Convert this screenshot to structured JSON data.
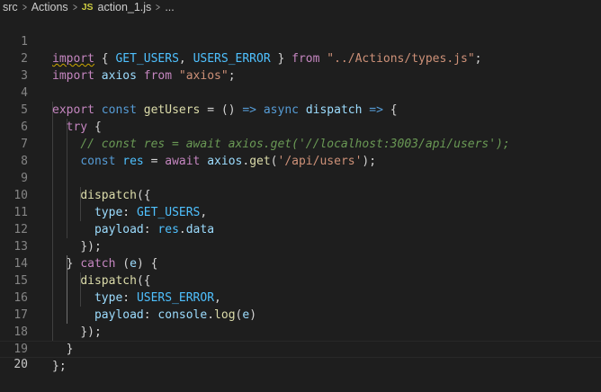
{
  "breadcrumb": {
    "items": [
      "src",
      "Actions",
      "action_1.js",
      "..."
    ],
    "file_badge": "JS"
  },
  "editor": {
    "line_numbers": [
      "1",
      "2",
      "3",
      "4",
      "5",
      "6",
      "7",
      "8",
      "9",
      "10",
      "11",
      "12",
      "13",
      "14",
      "15",
      "16",
      "17",
      "18",
      "19",
      "20"
    ],
    "tokens": {
      "l1_import": "import",
      "l1_b1": " { ",
      "l1_c1": "GET_USERS",
      "l1_comma": ", ",
      "l1_c2": "USERS_ERROR",
      "l1_b2": " } ",
      "l1_from": "from",
      "l1_sp": " ",
      "l1_path": "\"../Actions/types.js\"",
      "l1_semi": ";",
      "l2_import": "import",
      "l2_sp1": " ",
      "l2_axios": "axios",
      "l2_sp2": " ",
      "l2_from": "from",
      "l2_sp3": " ",
      "l2_str": "\"axios\"",
      "l2_semi": ";",
      "l4_export": "export",
      "l4_sp1": " ",
      "l4_const": "const",
      "l4_sp2": " ",
      "l4_name": "getUsers",
      "l4_eq": " = () ",
      "l4_arrow1": "=>",
      "l4_sp3": " ",
      "l4_async": "async",
      "l4_sp4": " ",
      "l4_dispatch": "dispatch",
      "l4_sp5": " ",
      "l4_arrow2": "=>",
      "l4_brace": " {",
      "l5_try": "try",
      "l5_brace": " {",
      "l6_comment": "// const res = await axios.get('//localhost:3003/api/users');",
      "l7_const": "const",
      "l7_sp1": " ",
      "l7_res": "res",
      "l7_eq": " = ",
      "l7_await": "await",
      "l7_sp2": " ",
      "l7_axios": "axios",
      "l7_dot": ".",
      "l7_get": "get",
      "l7_open": "(",
      "l7_url": "'/api/users'",
      "l7_close": ");",
      "l9_dispatch": "dispatch",
      "l9_open": "({",
      "l10_type": "type",
      "l10_colon": ": ",
      "l10_val": "GET_USERS",
      "l10_comma": ",",
      "l11_payload": "payload",
      "l11_colon": ": ",
      "l11_res": "res",
      "l11_dot": ".",
      "l11_data": "data",
      "l12_close": "});",
      "l13_brace": "} ",
      "l13_catch": "catch",
      "l13_open": " (",
      "l13_e": "e",
      "l13_close": ") {",
      "l14_dispatch": "dispatch",
      "l14_open": "({",
      "l15_type": "type",
      "l15_colon": ": ",
      "l15_val": "USERS_ERROR",
      "l15_comma": ",",
      "l16_payload": "payload",
      "l16_colon": ": ",
      "l16_console": "console",
      "l16_dot": ".",
      "l16_log": "log",
      "l16_open": "(",
      "l16_e": "e",
      "l16_close": ")",
      "l17_close": "});",
      "l18_close": "}",
      "l19_close": "};"
    }
  },
  "colors": {
    "background": "#1e1e1e",
    "keyword_control": "#c586c0",
    "keyword": "#569cd6",
    "variable": "#9cdcfe",
    "constant": "#4fc1ff",
    "function": "#dcdcaa",
    "string": "#ce9178",
    "comment": "#6a9955"
  }
}
